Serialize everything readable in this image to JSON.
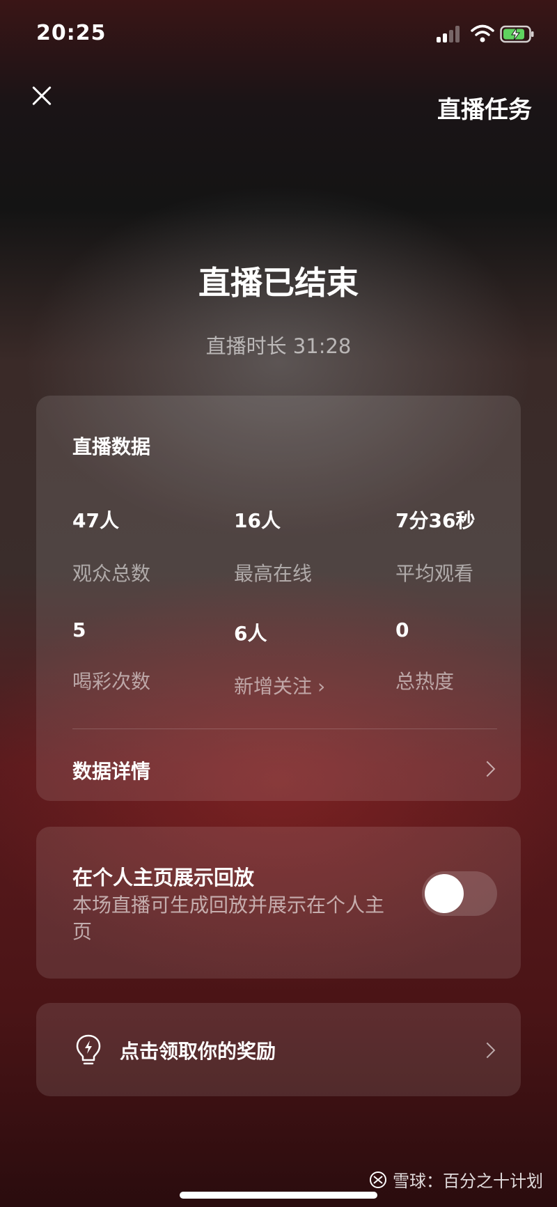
{
  "status_bar": {
    "time": "20:25",
    "signal_icon": "cellular-signal-icon",
    "wifi_icon": "wifi-icon",
    "battery_icon": "battery-charging-icon"
  },
  "header": {
    "close_icon": "close-icon",
    "task_link": "直播任务"
  },
  "summary": {
    "title": "直播已结束",
    "duration": "直播时长 31:28"
  },
  "stats": {
    "title": "直播数据",
    "items": [
      {
        "value": "47人",
        "label": "观众总数"
      },
      {
        "value": "16人",
        "label": "最高在线"
      },
      {
        "value": "7分36秒",
        "label": "平均观看"
      },
      {
        "value": "5",
        "label": "喝彩次数"
      },
      {
        "value": "6人",
        "label": "新增关注",
        "chevron": "›"
      },
      {
        "value": "0",
        "label": "总热度"
      }
    ],
    "details_label": "数据详情"
  },
  "replay": {
    "title": "在个人主页展示回放",
    "description": "本场直播可生成回放并展示在个人主页",
    "enabled": false
  },
  "reward": {
    "icon": "lightbulb-lightning-icon",
    "label": "点击领取你的奖励"
  },
  "watermark": {
    "text": "雪球：百分之十计划"
  },
  "colors": {
    "background_top": "#141414",
    "background_bottom": "#4a1416",
    "card": "rgba(255,255,255,0.11)",
    "text_primary": "#ffffff",
    "text_secondary": "rgba(255,255,255,0.55)"
  }
}
